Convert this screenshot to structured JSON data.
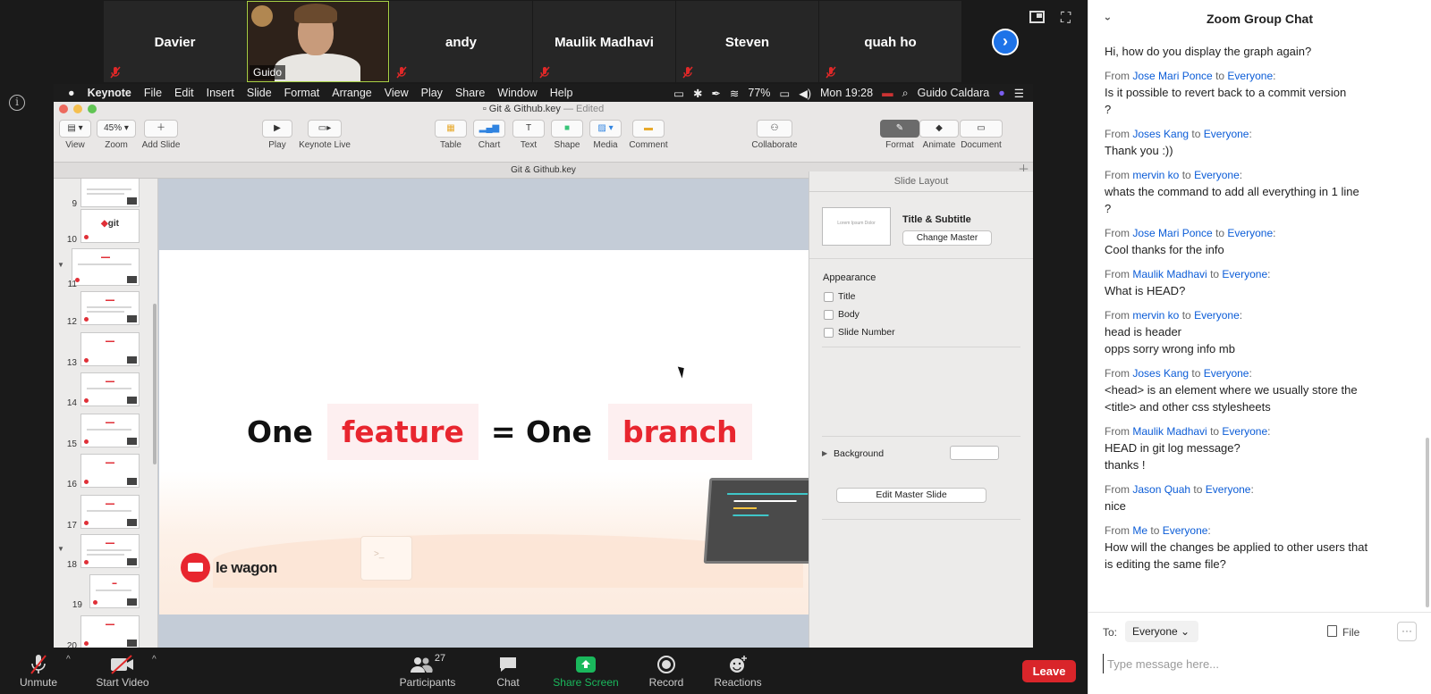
{
  "participants": [
    {
      "name": "Davier"
    },
    {
      "name": "andy"
    },
    {
      "name": "Maulik Madhavi"
    },
    {
      "name": "Steven"
    },
    {
      "name": "quah ho"
    }
  ],
  "video_participant": {
    "name": "Guido"
  },
  "keynote": {
    "menu": [
      "Keynote",
      "File",
      "Edit",
      "Insert",
      "Slide",
      "Format",
      "Arrange",
      "View",
      "Play",
      "Share",
      "Window",
      "Help"
    ],
    "status": {
      "battery": "77%",
      "clock": "Mon 19:28",
      "user": "Guido Caldara"
    },
    "window_title": "Git & Github.key",
    "window_status": "— Edited",
    "toolbar": {
      "view": "View",
      "zoom_value": "45%",
      "zoom": "Zoom",
      "add_slide": "Add Slide",
      "play": "Play",
      "keynote_live": "Keynote Live",
      "table": "Table",
      "chart": "Chart",
      "text": "Text",
      "shape": "Shape",
      "media": "Media",
      "comment": "Comment",
      "collaborate": "Collaborate",
      "format": "Format",
      "animate": "Animate",
      "document": "Document"
    },
    "doc_tab": "Git & Github.key",
    "slide_numbers": [
      "9",
      "10",
      "11",
      "12",
      "13",
      "14",
      "15",
      "16",
      "17",
      "18",
      "19",
      "20"
    ],
    "thumb_git": "git",
    "slide": {
      "w1": "One",
      "h1": "feature",
      "w2": "= One",
      "h2": "branch",
      "logo": "le wagon",
      "mug": ">_"
    },
    "inspector": {
      "header": "Slide Layout",
      "master_name": "Title & Subtitle",
      "master_thumb": "Lorem Ipsum Dolor",
      "change_master": "Change Master",
      "appearance": "Appearance",
      "checkbox_title": "Title",
      "checkbox_body": "Body",
      "checkbox_slide_number": "Slide Number",
      "background": "Background",
      "edit_master": "Edit Master Slide"
    }
  },
  "controls": {
    "unmute": "Unmute",
    "start_video": "Start Video",
    "participants": "Participants",
    "participants_count": "27",
    "chat": "Chat",
    "share_screen": "Share Screen",
    "record": "Record",
    "reactions": "Reactions",
    "leave": "Leave"
  },
  "chat": {
    "title": "Zoom Group Chat",
    "messages": [
      {
        "from": "",
        "to": "",
        "text": "Hi, how do you display the graph again?"
      },
      {
        "from": "Jose Mari Ponce",
        "to": "Everyone",
        "text": "Is it possible to revert back to a commit version\n?"
      },
      {
        "from": "Joses Kang",
        "to": "Everyone",
        "text": "Thank you :))"
      },
      {
        "from": "mervin ko",
        "to": "Everyone",
        "text": "whats the command to add all everything in 1 line\n?"
      },
      {
        "from": "Jose Mari Ponce",
        "to": "Everyone",
        "text": "Cool thanks for the info"
      },
      {
        "from": "Maulik Madhavi",
        "to": "Everyone",
        "text": "What is HEAD?"
      },
      {
        "from": "mervin ko",
        "to": "Everyone",
        "text": "head is header\nopps sorry wrong info mb"
      },
      {
        "from": "Joses Kang",
        "to": "Everyone",
        "text": "<head> is an element where we usually store the\n<title> and other css stylesheets"
      },
      {
        "from": "Maulik Madhavi",
        "to": "Everyone",
        "text": "HEAD in git log message?\nthanks !"
      },
      {
        "from": "Jason Quah",
        "to": "Everyone",
        "text": "nice"
      },
      {
        "from": "Me",
        "to": "Everyone",
        "text": "How will the changes be applied to other users that\nis editing the same file?"
      }
    ],
    "from_word": "From",
    "to_word": "to",
    "to_label": "To:",
    "recipient": "Everyone",
    "file": "File",
    "placeholder": "Type message here..."
  },
  "colors": {
    "accent": "#e8262f",
    "zoom_blue": "#0b5cd7",
    "share_green": "#1ab85c",
    "leave_red": "#d9252a",
    "active_speaker": "#a8d245"
  }
}
